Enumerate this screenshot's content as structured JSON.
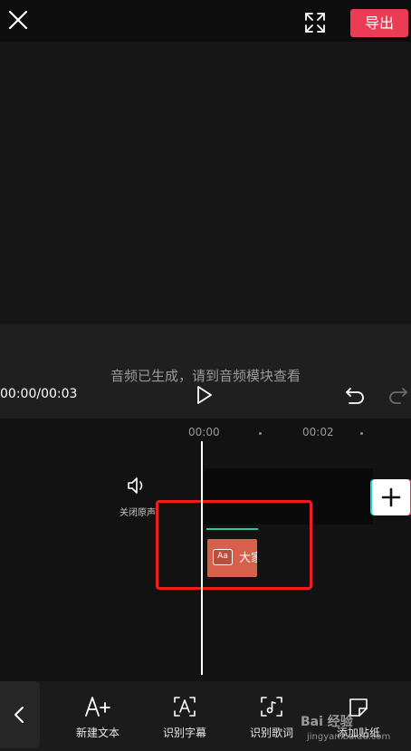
{
  "topbar": {
    "export_label": "导出",
    "close_icon": "close-icon",
    "fullscreen_icon": "fullscreen-icon"
  },
  "player": {
    "toast": "音频已生成，请到音频模块查看",
    "time": "00:00/00:03"
  },
  "timeline": {
    "ticks": [
      "00:00",
      "00:02"
    ],
    "mute_label": "关闭原声",
    "text_clip_label": "大家"
  },
  "toolbar": {
    "items": [
      {
        "label": "新建文本",
        "icon": "add-text-icon"
      },
      {
        "label": "识别字幕",
        "icon": "recognize-subtitle-icon"
      },
      {
        "label": "识别歌词",
        "icon": "recognize-lyrics-icon"
      },
      {
        "label": "添加贴纸",
        "icon": "sticker-icon"
      }
    ]
  },
  "watermark": {
    "main": "Bai 经验",
    "sub": "jingyan.baidu.com"
  },
  "colors": {
    "accent": "#ec3b55",
    "clip": "#d6604c",
    "highlight": "#ef1e1e",
    "audio_line": "#27c4a0"
  }
}
